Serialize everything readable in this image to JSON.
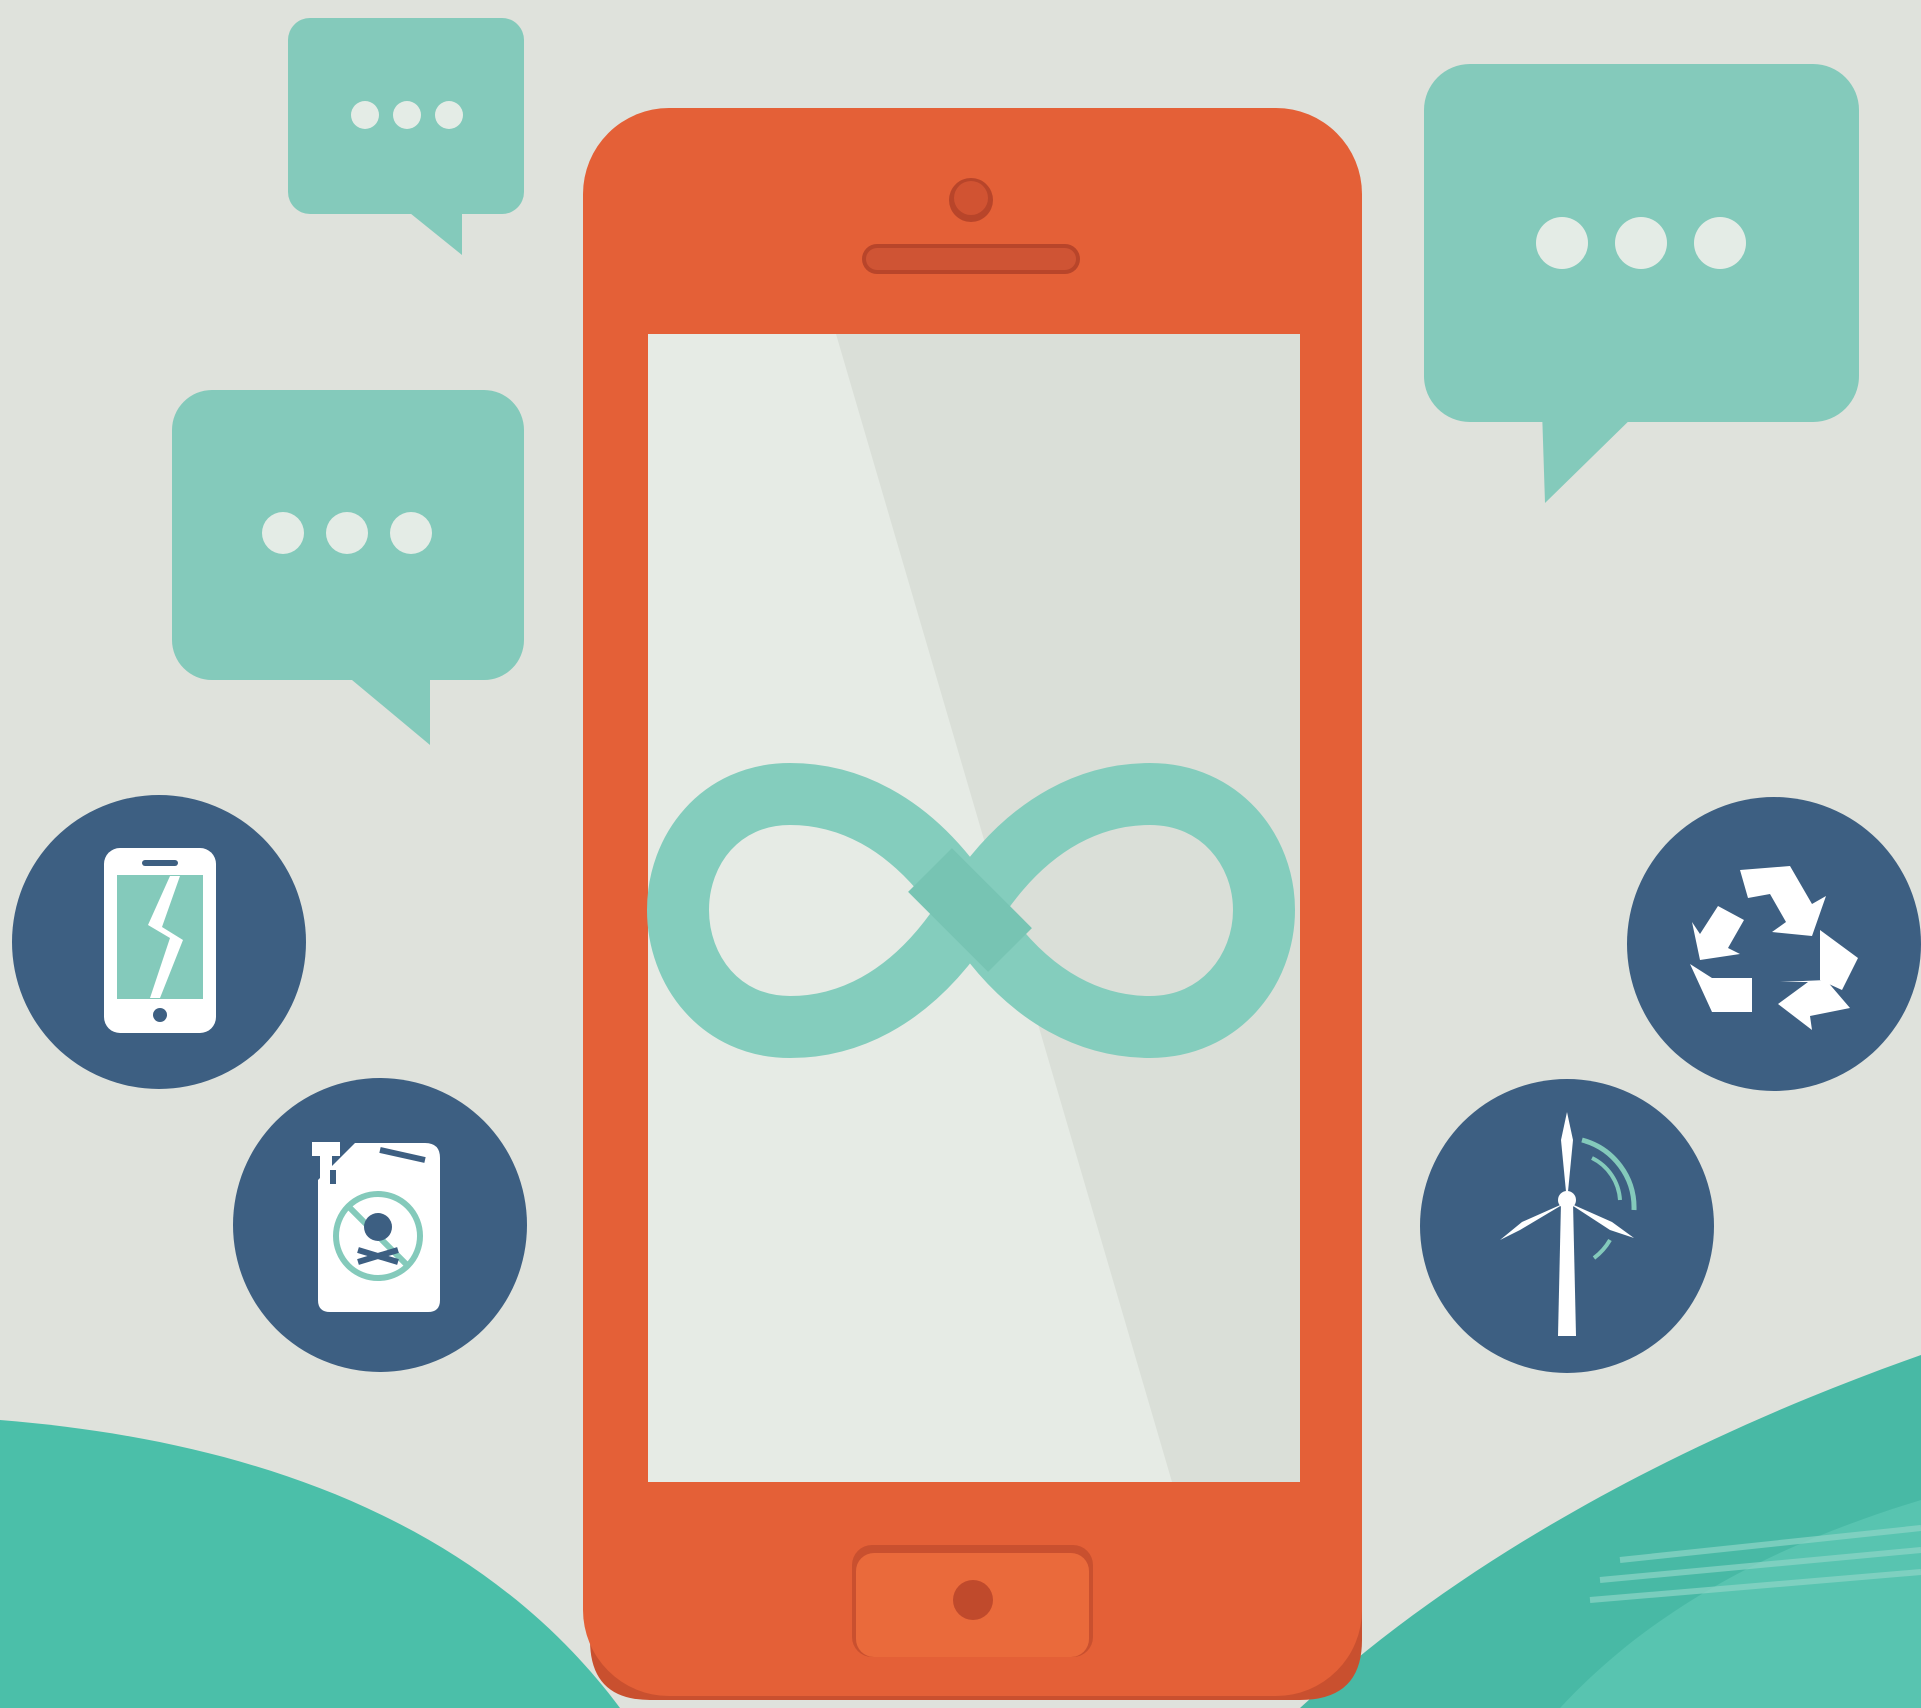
{
  "colors": {
    "background": "#dfe2dc",
    "phone_body": "#e46037",
    "phone_shadow": "#c9502f",
    "screen": "#e6ebe5",
    "screen_shade": "#dadfd8",
    "speech_bubble": "#84cabb",
    "icon_circle": "#3d5f82",
    "infinity": "#84cdbd",
    "hills": "#4bbfa9"
  },
  "illustration": {
    "phone": {
      "icon": "smartphone-icon"
    },
    "screen_symbol": "infinity-icon",
    "speech_bubbles": [
      {
        "name": "speech-bubble-small-top-left",
        "icon": "ellipsis-icon"
      },
      {
        "name": "speech-bubble-left",
        "icon": "ellipsis-icon"
      },
      {
        "name": "speech-bubble-right",
        "icon": "ellipsis-icon"
      }
    ],
    "icon_badges": [
      {
        "name": "broken-phone-badge",
        "icon": "broken-phone-icon"
      },
      {
        "name": "toxic-canister-badge",
        "icon": "toxic-canister-icon"
      },
      {
        "name": "recycle-badge",
        "icon": "recycle-icon"
      },
      {
        "name": "wind-turbine-badge",
        "icon": "wind-turbine-icon"
      }
    ]
  }
}
